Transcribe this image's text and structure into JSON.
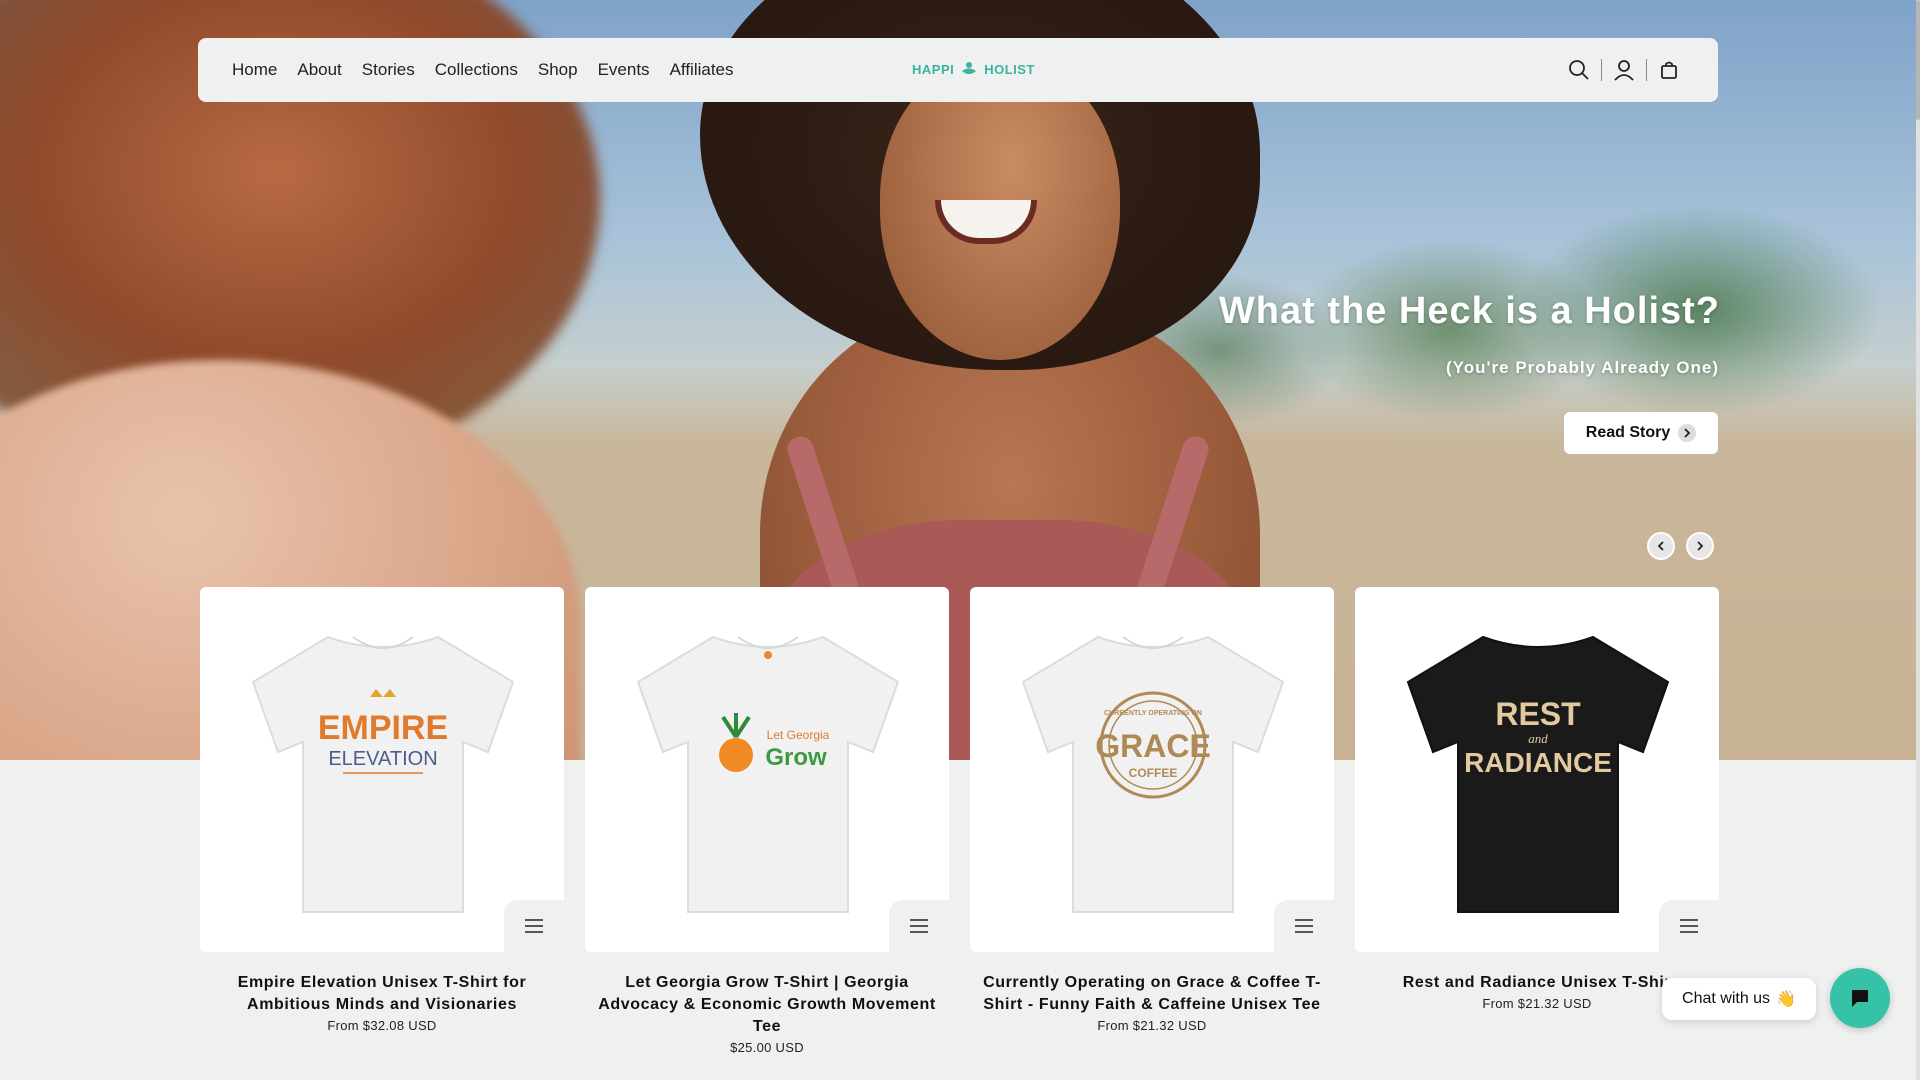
{
  "nav": {
    "links": [
      "Home",
      "About",
      "Stories",
      "Collections",
      "Shop",
      "Events",
      "Affiliates"
    ],
    "logo": {
      "left": "HAPPI",
      "right": "HOLIST"
    },
    "icons": [
      "search-icon",
      "account-icon",
      "cart-icon"
    ]
  },
  "hero": {
    "title": "What the Heck is a Holist?",
    "subtitle": "(You're Probably Already One)",
    "button": "Read Story"
  },
  "products": [
    {
      "title": "Empire Elevation Unisex T-Shirt for Ambitious Minds and Visionaries",
      "price": "From $32.08 USD",
      "shirt_color": "#f1f1f1",
      "graphic": [
        "EMPIRE",
        "ELEVATION"
      ]
    },
    {
      "title": "Let Georgia Grow T-Shirt | Georgia Advocacy & Economic Growth Movement Tee",
      "price": "$25.00 USD",
      "shirt_color": "#f1f1f1",
      "graphic": [
        "Let Georgia",
        "Grow"
      ]
    },
    {
      "title": "Currently Operating on Grace & Coffee T-Shirt - Funny Faith & Caffeine Unisex Tee",
      "price": "From $21.32 USD",
      "shirt_color": "#f1f1f1",
      "graphic": [
        "CURRENTLY OPERATING ON",
        "GRACE",
        "COFFEE"
      ]
    },
    {
      "title": "Rest and Radiance Unisex T-Shir",
      "price": "From $21.32 USD",
      "shirt_color": "#1a1a1a",
      "graphic": [
        "REST",
        "and",
        "RADIANCE"
      ]
    }
  ],
  "chat": {
    "label": "Chat with us",
    "emoji": "👋"
  },
  "colors": {
    "accent": "#35c2a6",
    "background": "#eff1f1"
  }
}
